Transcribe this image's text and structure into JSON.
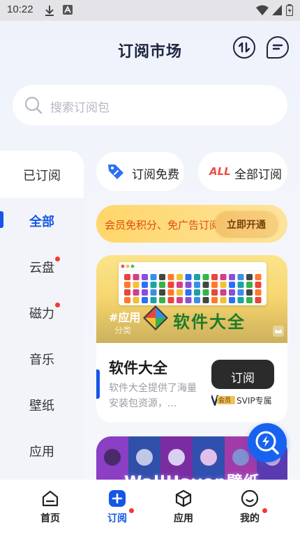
{
  "status_bar": {
    "time": "10:22"
  },
  "header": {
    "title": "订阅市场"
  },
  "search": {
    "placeholder": "搜索订阅包"
  },
  "sidebar": {
    "subscribed_label": "已订阅",
    "items": [
      {
        "label": "全部",
        "active": true
      },
      {
        "label": "云盘",
        "has_dot": true
      },
      {
        "label": "磁力",
        "has_dot": true
      },
      {
        "label": "音乐"
      },
      {
        "label": "壁纸"
      },
      {
        "label": "应用"
      }
    ]
  },
  "chips": {
    "free": {
      "label": "订阅免费"
    },
    "all": {
      "badge": "ALL",
      "label": "全部订阅"
    }
  },
  "banner": {
    "text": "会员免积分、免广告订阅",
    "button_label": "立即开通"
  },
  "card": {
    "cover_tag": "#应用",
    "cover_subtag": "分类",
    "cover_title": "软件大全",
    "title": "软件大全",
    "description": "软件大全提供了海量安装包资源，...",
    "button_label": "订阅",
    "vip_badge": "会员",
    "vip_label": "SVIP专属"
  },
  "card2": {
    "cover_title": "WallHaven壁纸"
  },
  "bottom_nav": [
    {
      "label": "首页",
      "icon": "home-icon"
    },
    {
      "label": "订阅",
      "icon": "subscribe-icon",
      "active": true,
      "has_dot": true
    },
    {
      "label": "应用",
      "icon": "cube-icon"
    },
    {
      "label": "我的",
      "icon": "profile-icon",
      "has_dot": true
    }
  ],
  "colors": {
    "accent": "#1457e6",
    "badge_red": "#f5382f",
    "banner_text": "#e04a12"
  }
}
